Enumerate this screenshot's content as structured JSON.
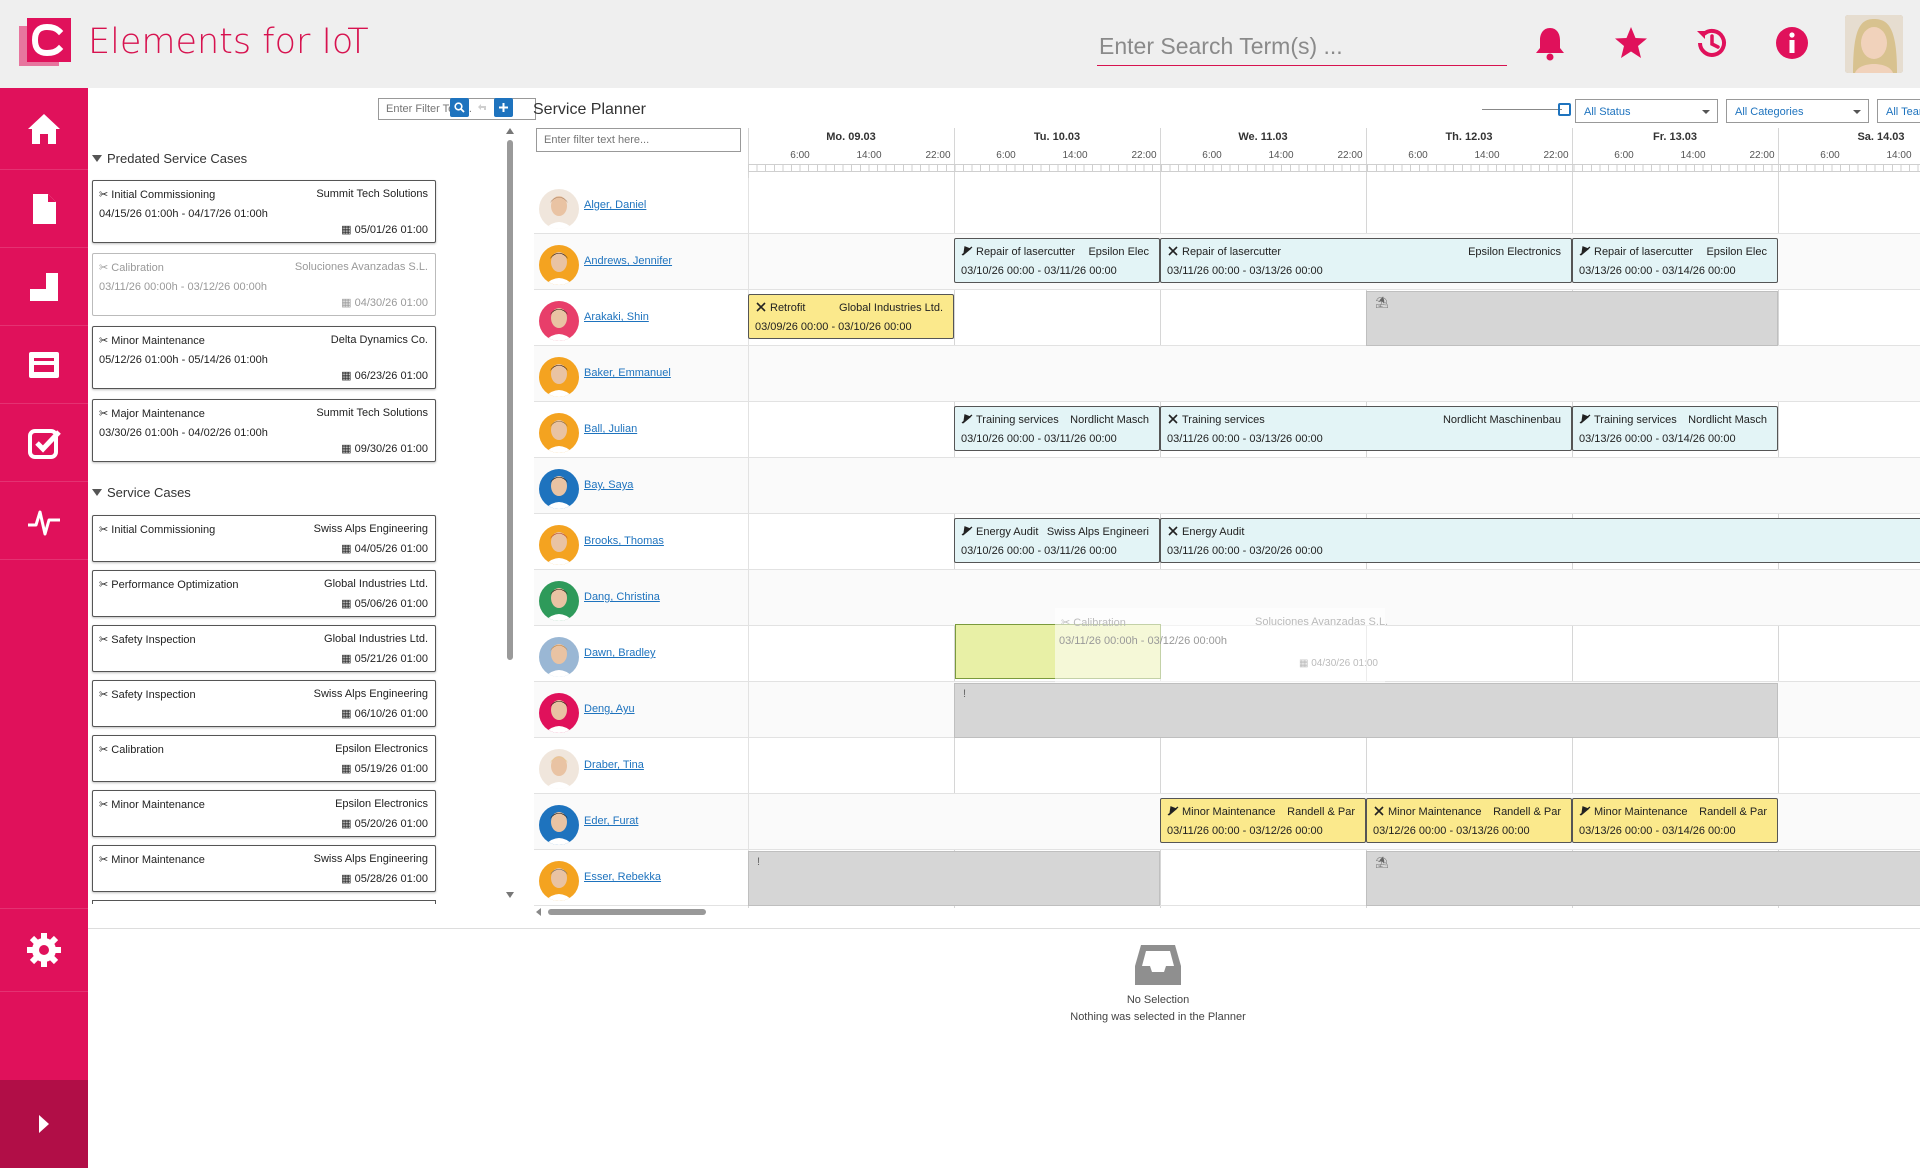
{
  "app": {
    "title": "Elements for IoT"
  },
  "header": {
    "search_placeholder": "Enter Search Term(s) ..."
  },
  "left": {
    "filter_placeholder": "Enter Filter Text...",
    "sections": [
      {
        "title": "Predated Service Cases"
      },
      {
        "title": "Service Cases"
      }
    ],
    "predated": [
      {
        "title": "Initial Commissioning",
        "customer": "Summit Tech Solutions",
        "range": "04/15/26 01:00h - 04/17/26 01:00h",
        "due": "05/01/26 01:00"
      },
      {
        "title": "Calibration",
        "customer": "Soluciones Avanzadas S.L.",
        "range": "03/11/26 00:00h - 03/12/26 00:00h",
        "due": "04/30/26 01:00"
      },
      {
        "title": "Minor Maintenance",
        "customer": "Delta Dynamics Co.",
        "range": "05/12/26 01:00h - 05/14/26 01:00h",
        "due": "06/23/26 01:00"
      },
      {
        "title": "Major Maintenance",
        "customer": "Summit Tech Solutions",
        "range": "03/30/26 01:00h - 04/02/26 01:00h",
        "due": "09/30/26 01:00"
      }
    ],
    "cases": [
      {
        "title": "Initial Commissioning",
        "customer": "Swiss Alps Engineering",
        "due": "04/05/26 01:00"
      },
      {
        "title": "Performance Optimization",
        "customer": "Global Industries Ltd.",
        "due": "05/06/26 01:00"
      },
      {
        "title": "Safety Inspection",
        "customer": "Global Industries Ltd.",
        "due": "05/21/26 01:00"
      },
      {
        "title": "Safety Inspection",
        "customer": "Swiss Alps Engineering",
        "due": "06/10/26 01:00"
      },
      {
        "title": "Calibration",
        "customer": "Epsilon Electronics",
        "due": "05/19/26 01:00"
      },
      {
        "title": "Minor Maintenance",
        "customer": "Epsilon Electronics",
        "due": "05/20/26 01:00"
      },
      {
        "title": "Minor Maintenance",
        "customer": "Swiss Alps Engineering",
        "due": "05/28/26 01:00"
      }
    ]
  },
  "planner": {
    "title": "Service Planner",
    "filter_placeholder": "Enter filter text here...",
    "status_filter": "All Status",
    "category_filter": "All Categories",
    "team_filter": "All Teams",
    "days": [
      "Mo. 09.03",
      "Tu. 10.03",
      "We. 11.03",
      "Th. 12.03",
      "Fr. 13.03",
      "Sa. 14.03"
    ],
    "hours": [
      "6:00",
      "14:00",
      "22:00"
    ],
    "people": [
      "Alger, Daniel",
      "Andrews, Jennifer",
      "Arakaki, Shin",
      "Baker, Emmanuel",
      "Ball, Julian",
      "Bay, Saya",
      "Brooks, Thomas",
      "Dang, Christina",
      "Dawn, Bradley",
      "Deng, Ayu",
      "Draber, Tina",
      "Eder, Furat",
      "Esser, Rebekka"
    ],
    "events": [
      {
        "row": 1,
        "start": 1,
        "end": 2,
        "title": "Repair of lasercutter",
        "customer": "Epsilon Elec",
        "range": "03/10/26 00:00 - 03/11/26 00:00",
        "color": "blue",
        "icon": "plane"
      },
      {
        "row": 1,
        "start": 2,
        "end": 4,
        "title": "Repair of lasercutter",
        "customer": "Epsilon Electronics",
        "range": "03/11/26 00:00 - 03/13/26 00:00",
        "color": "blue",
        "icon": "tools"
      },
      {
        "row": 1,
        "start": 4,
        "end": 5,
        "title": "Repair of lasercutter",
        "customer": "Epsilon Elec",
        "range": "03/13/26 00:00 - 03/14/26 00:00",
        "color": "blue",
        "icon": "plane"
      },
      {
        "row": 2,
        "start": 0,
        "end": 1,
        "title": "Retrofit",
        "customer": "Global Industries Ltd.",
        "range": "03/09/26 00:00 - 03/10/26 00:00",
        "color": "yellow",
        "icon": "tools"
      },
      {
        "row": 4,
        "start": 1,
        "end": 2,
        "title": "Training services",
        "customer": "Nordlicht Masch",
        "range": "03/10/26 00:00 - 03/11/26 00:00",
        "color": "blue",
        "icon": "plane"
      },
      {
        "row": 4,
        "start": 2,
        "end": 4,
        "title": "Training services",
        "customer": "Nordlicht Maschinenbau",
        "range": "03/11/26 00:00 - 03/13/26 00:00",
        "color": "blue",
        "icon": "tools"
      },
      {
        "row": 4,
        "start": 4,
        "end": 5,
        "title": "Training services",
        "customer": "Nordlicht Masch",
        "range": "03/13/26 00:00 - 03/14/26 00:00",
        "color": "blue",
        "icon": "plane"
      },
      {
        "row": 6,
        "start": 1,
        "end": 2,
        "title": "Energy Audit",
        "customer": "Swiss Alps Engineeri",
        "range": "03/10/26 00:00 - 03/11/26 00:00",
        "color": "blue",
        "icon": "plane"
      },
      {
        "row": 6,
        "start": 2,
        "end": 6,
        "title": "Energy Audit",
        "customer": "",
        "range": "03/11/26 00:00 - 03/20/26 00:00",
        "color": "blue",
        "icon": "tools"
      },
      {
        "row": 11,
        "start": 2,
        "end": 3,
        "title": "Minor Maintenance",
        "customer": "Randell & Par",
        "range": "03/11/26 00:00 - 03/12/26 00:00",
        "color": "yellow",
        "icon": "plane"
      },
      {
        "row": 11,
        "start": 3,
        "end": 4,
        "title": "Minor Maintenance",
        "customer": "Randell & Par",
        "range": "03/12/26 00:00 - 03/13/26 00:00",
        "color": "yellow",
        "icon": "tools"
      },
      {
        "row": 11,
        "start": 4,
        "end": 5,
        "title": "Minor Maintenance",
        "customer": "Randell & Par",
        "range": "03/13/26 00:00 - 03/14/26 00:00",
        "color": "yellow",
        "icon": "plane"
      }
    ],
    "absences": [
      {
        "row": 2,
        "start": 3,
        "end": 5,
        "icon": "beach-icon"
      },
      {
        "row": 9,
        "start": 1,
        "end": 5,
        "icon": "thermometer-icon"
      },
      {
        "row": 12,
        "start": 0,
        "end": 2,
        "icon": "thermometer-icon"
      },
      {
        "row": 12,
        "start": 3,
        "end": 6,
        "icon": "beach-icon"
      }
    ],
    "drag_ghost": {
      "title": "Calibration",
      "customer": "Soluciones Avanzadas S.L.",
      "range": "03/11/26 00:00h - 03/12/26 00:00h",
      "due": "04/30/26 01:00"
    }
  },
  "detail": {
    "title": "No Selection",
    "message": "Nothing was selected in the Planner"
  },
  "colors": {
    "accent": "#e0115b",
    "link": "#1e73be",
    "event_blue": "#e3f4f6",
    "event_yellow": "#fbe98c",
    "absence": "#d6d6d6",
    "drop_target": "#e8f0a6"
  }
}
